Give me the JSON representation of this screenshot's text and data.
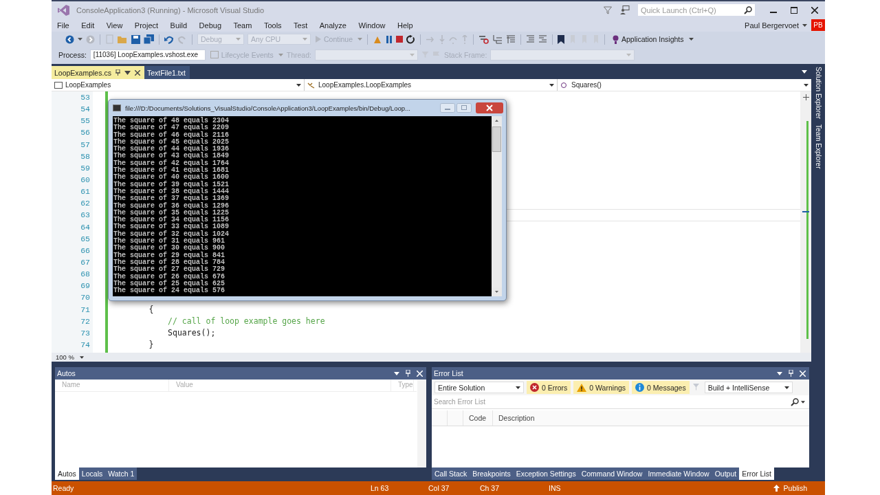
{
  "window": {
    "title": "ConsoleApplication3 (Running) - Microsoft Visual Studio"
  },
  "quick_launch": {
    "placeholder": "Quick Launch (Ctrl+Q)"
  },
  "menu": [
    "File",
    "Edit",
    "View",
    "Project",
    "Build",
    "Debug",
    "Team",
    "Tools",
    "Test",
    "Analyze",
    "Window",
    "Help"
  ],
  "user": {
    "name": "Paul Bergervoet",
    "initials": "PB"
  },
  "toolbar": {
    "combos": [
      {
        "label": "Debug",
        "disabled": true
      },
      {
        "label": "Any CPU",
        "disabled": true
      }
    ],
    "continue": {
      "label": "Continue",
      "disabled": true
    },
    "insights": "Application Insights"
  },
  "debug_location": {
    "process_label": "Process:",
    "process": "[11036] LoopExamples.vshost.exe",
    "lifecycle": "Lifecycle Events",
    "thread_label": "Thread:",
    "stack_frame_label": "Stack Frame:"
  },
  "document_tabs": [
    {
      "label": "LoopExamples.cs",
      "selected": true
    },
    {
      "label": "TextFile1.txt",
      "selected": false
    }
  ],
  "navigation": [
    "LoopExamples",
    "LoopExamples.LoopExamples",
    "Squares()"
  ],
  "editor": {
    "zoom": "100 %",
    "lines": [
      {
        "number": "53",
        "current": false
      },
      {
        "number": "54",
        "current": false
      },
      {
        "number": "55",
        "current": false
      },
      {
        "number": "56",
        "current": false
      },
      {
        "number": "57",
        "current": false
      },
      {
        "number": "58",
        "current": false
      },
      {
        "number": "59",
        "current": false
      },
      {
        "number": "60",
        "current": false
      },
      {
        "number": "61",
        "current": false
      },
      {
        "number": "62",
        "current": false
      },
      {
        "number": "63",
        "current": true
      },
      {
        "number": "64",
        "current": false
      },
      {
        "number": "65",
        "current": false
      },
      {
        "number": "66",
        "current": false
      },
      {
        "number": "67",
        "current": false
      },
      {
        "number": "68",
        "current": false
      },
      {
        "number": "69",
        "current": false
      },
      {
        "number": "70",
        "current": false
      },
      {
        "number": "71",
        "current": false,
        "kind": "code",
        "code": "        {"
      },
      {
        "number": "72",
        "current": false,
        "kind": "comment",
        "code": "            // call of loop example goes here"
      },
      {
        "number": "73",
        "current": false,
        "kind": "code",
        "code": "            Squares();"
      },
      {
        "number": "74",
        "current": false,
        "kind": "code",
        "code": "        }"
      }
    ]
  },
  "side_tabs": [
    "Solution Explorer",
    "Team Explorer"
  ],
  "console": {
    "title": "file:///D:/Documents/Solutions_VisualStudio/ConsoleApplication3/LoopExamples/bin/Debug/Loop...",
    "lines": [
      "The square of 48 equals 2304",
      "The square of 47 equals 2209",
      "The square of 46 equals 2116",
      "The square of 45 equals 2025",
      "The square of 44 equals 1936",
      "The square of 43 equals 1849",
      "The square of 42 equals 1764",
      "The square of 41 equals 1681",
      "The square of 40 equals 1600",
      "The square of 39 equals 1521",
      "The square of 38 equals 1444",
      "The square of 37 equals 1369",
      "The square of 36 equals 1296",
      "The square of 35 equals 1225",
      "The square of 34 equals 1156",
      "The square of 33 equals 1089",
      "The square of 32 equals 1024",
      "The square of 31 equals 961",
      "The square of 30 equals 900",
      "The square of 29 equals 841",
      "The square of 28 equals 784",
      "The square of 27 equals 729",
      "The square of 26 equals 676",
      "The square of 25 equals 625",
      "The square of 24 equals 576"
    ]
  },
  "autos": {
    "title": "Autos",
    "columns": [
      "Name",
      "Value",
      "Type"
    ],
    "tabs": [
      {
        "label": "Autos",
        "selected": true
      },
      {
        "label": "Locals",
        "selected": false
      },
      {
        "label": "Watch 1",
        "selected": false
      }
    ]
  },
  "error_list": {
    "title": "Error List",
    "scope": "Entire Solution",
    "filters": [
      {
        "kind": "error",
        "label": "0 Errors",
        "on": true
      },
      {
        "kind": "warning",
        "label": "0 Warnings",
        "on": true
      },
      {
        "kind": "message",
        "label": "0 Messages",
        "on": true
      }
    ],
    "source": "Build + IntelliSense",
    "search": {
      "placeholder": "Search Error List"
    },
    "columns": [
      "Code",
      "Description"
    ],
    "tabs": [
      {
        "label": "Call Stack",
        "selected": false
      },
      {
        "label": "Breakpoints",
        "selected": false
      },
      {
        "label": "Exception Settings",
        "selected": false
      },
      {
        "label": "Command Window",
        "selected": false
      },
      {
        "label": "Immediate Window",
        "selected": false
      },
      {
        "label": "Output",
        "selected": false
      },
      {
        "label": "Error List",
        "selected": true
      }
    ]
  },
  "status_bar": {
    "state": "Ready",
    "line": "Ln 63",
    "column": "Col 37",
    "char": "Ch 37",
    "mode": "INS",
    "publish": "Publish"
  }
}
